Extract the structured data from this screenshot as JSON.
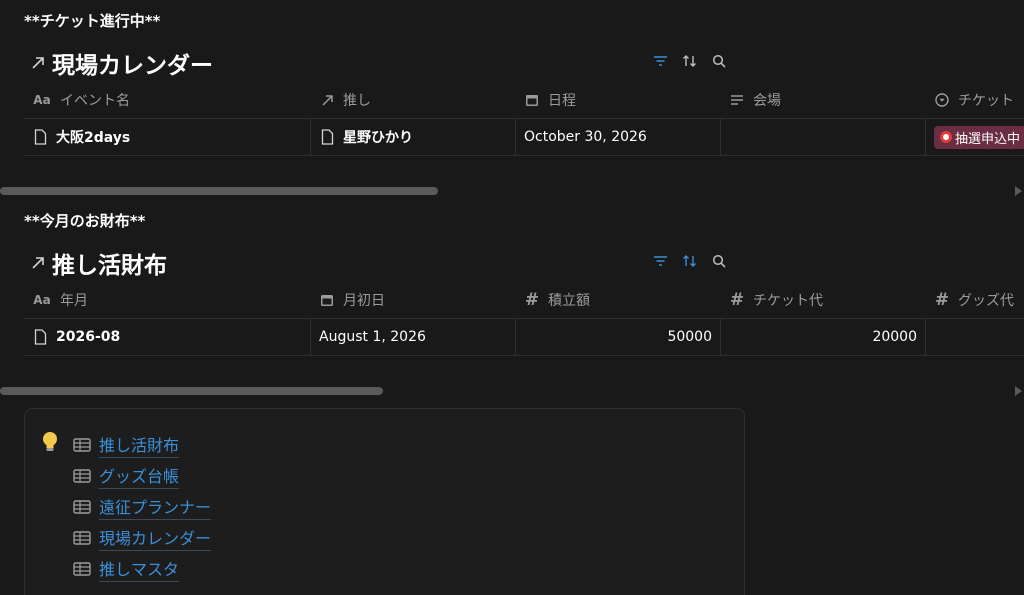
{
  "section1": {
    "heading": "**チケット進行中**",
    "title": "現場カレンダー",
    "columns": [
      "イベント名",
      "推し",
      "日程",
      "会場",
      "チケット"
    ],
    "row": {
      "event": "大阪2days",
      "oshi": "星野ひかり",
      "date": "October 30, 2026",
      "venue": "",
      "ticket_tag": "抽選申込中"
    }
  },
  "section2": {
    "heading": "**今月のお財布**",
    "title": "推し活財布",
    "columns": [
      "年月",
      "月初日",
      "積立額",
      "チケット代",
      "グッズ代"
    ],
    "row": {
      "month": "2026-08",
      "first_day": "August 1, 2026",
      "savings": "50000",
      "ticket_cost": "20000",
      "goods_cost": ""
    }
  },
  "callout": {
    "icon": "lightbulb-icon",
    "links": [
      "推し活財布",
      "グッズ台帳",
      "遠征プランナー",
      "現場カレンダー",
      "推しマスタ"
    ]
  },
  "colors": {
    "background": "#191919",
    "accent": "#3b8fd8",
    "tag": "#6b2d44"
  }
}
